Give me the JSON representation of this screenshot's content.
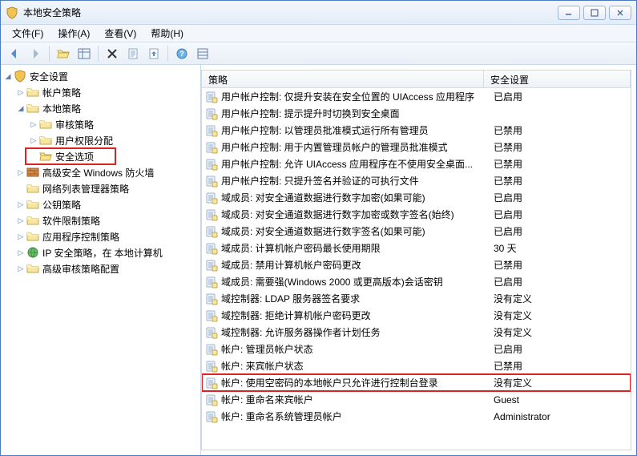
{
  "window": {
    "title": "本地安全策略"
  },
  "menus": [
    {
      "label": "文件(F)"
    },
    {
      "label": "操作(A)"
    },
    {
      "label": "查看(V)"
    },
    {
      "label": "帮助(H)"
    }
  ],
  "tree": {
    "root": {
      "label": "安全设置",
      "expanded": true
    },
    "items": [
      {
        "label": "帐户策略",
        "indent": 1,
        "exp": "▷",
        "icon": "folder"
      },
      {
        "label": "本地策略",
        "indent": 1,
        "exp": "◢",
        "icon": "folder"
      },
      {
        "label": "审核策略",
        "indent": 2,
        "exp": "▷",
        "icon": "folder"
      },
      {
        "label": "用户权限分配",
        "indent": 2,
        "exp": "▷",
        "icon": "folder"
      },
      {
        "label": "安全选项",
        "indent": 2,
        "exp": "",
        "icon": "folder-open",
        "highlight": true
      },
      {
        "label": "高级安全 Windows 防火墙",
        "indent": 1,
        "exp": "▷",
        "icon": "firewall"
      },
      {
        "label": "网络列表管理器策略",
        "indent": 1,
        "exp": "",
        "icon": "folder"
      },
      {
        "label": "公钥策略",
        "indent": 1,
        "exp": "▷",
        "icon": "folder"
      },
      {
        "label": "软件限制策略",
        "indent": 1,
        "exp": "▷",
        "icon": "folder"
      },
      {
        "label": "应用程序控制策略",
        "indent": 1,
        "exp": "▷",
        "icon": "folder"
      },
      {
        "label": "IP 安全策略，在 本地计算机",
        "indent": 1,
        "exp": "▷",
        "icon": "ip"
      },
      {
        "label": "高级审核策略配置",
        "indent": 1,
        "exp": "▷",
        "icon": "folder"
      }
    ]
  },
  "columns": {
    "policy": "策略",
    "setting": "安全设置"
  },
  "rows": [
    {
      "p": "用户帐户控制: 仅提升安装在安全位置的 UIAccess 应用程序",
      "s": "已启用"
    },
    {
      "p": "用户帐户控制: 提示提升时切换到安全桌面",
      "s": ""
    },
    {
      "p": "用户帐户控制: 以管理员批准模式运行所有管理员",
      "s": "已禁用"
    },
    {
      "p": "用户帐户控制: 用于内置管理员帐户的管理员批准模式",
      "s": "已禁用"
    },
    {
      "p": "用户帐户控制: 允许 UIAccess 应用程序在不使用安全桌面...",
      "s": "已禁用"
    },
    {
      "p": "用户帐户控制: 只提升签名并验证的可执行文件",
      "s": "已禁用"
    },
    {
      "p": "域成员: 对安全通道数据进行数字加密(如果可能)",
      "s": "已启用"
    },
    {
      "p": "域成员: 对安全通道数据进行数字加密或数字签名(始终)",
      "s": "已启用"
    },
    {
      "p": "域成员: 对安全通道数据进行数字签名(如果可能)",
      "s": "已启用"
    },
    {
      "p": "域成员: 计算机帐户密码最长使用期限",
      "s": "30 天"
    },
    {
      "p": "域成员: 禁用计算机帐户密码更改",
      "s": "已禁用"
    },
    {
      "p": "域成员: 需要强(Windows 2000 或更高版本)会话密钥",
      "s": "已启用"
    },
    {
      "p": "域控制器: LDAP 服务器签名要求",
      "s": "没有定义"
    },
    {
      "p": "域控制器: 拒绝计算机帐户密码更改",
      "s": "没有定义"
    },
    {
      "p": "域控制器: 允许服务器操作者计划任务",
      "s": "没有定义"
    },
    {
      "p": "帐户: 管理员帐户状态",
      "s": "已启用"
    },
    {
      "p": "帐户: 来宾帐户状态",
      "s": "已禁用"
    },
    {
      "p": "帐户: 使用空密码的本地帐户只允许进行控制台登录",
      "s": "没有定义",
      "hl": true
    },
    {
      "p": "帐户: 重命名来宾帐户",
      "s": "Guest"
    },
    {
      "p": "帐户: 重命名系统管理员帐户",
      "s": "Administrator"
    }
  ]
}
